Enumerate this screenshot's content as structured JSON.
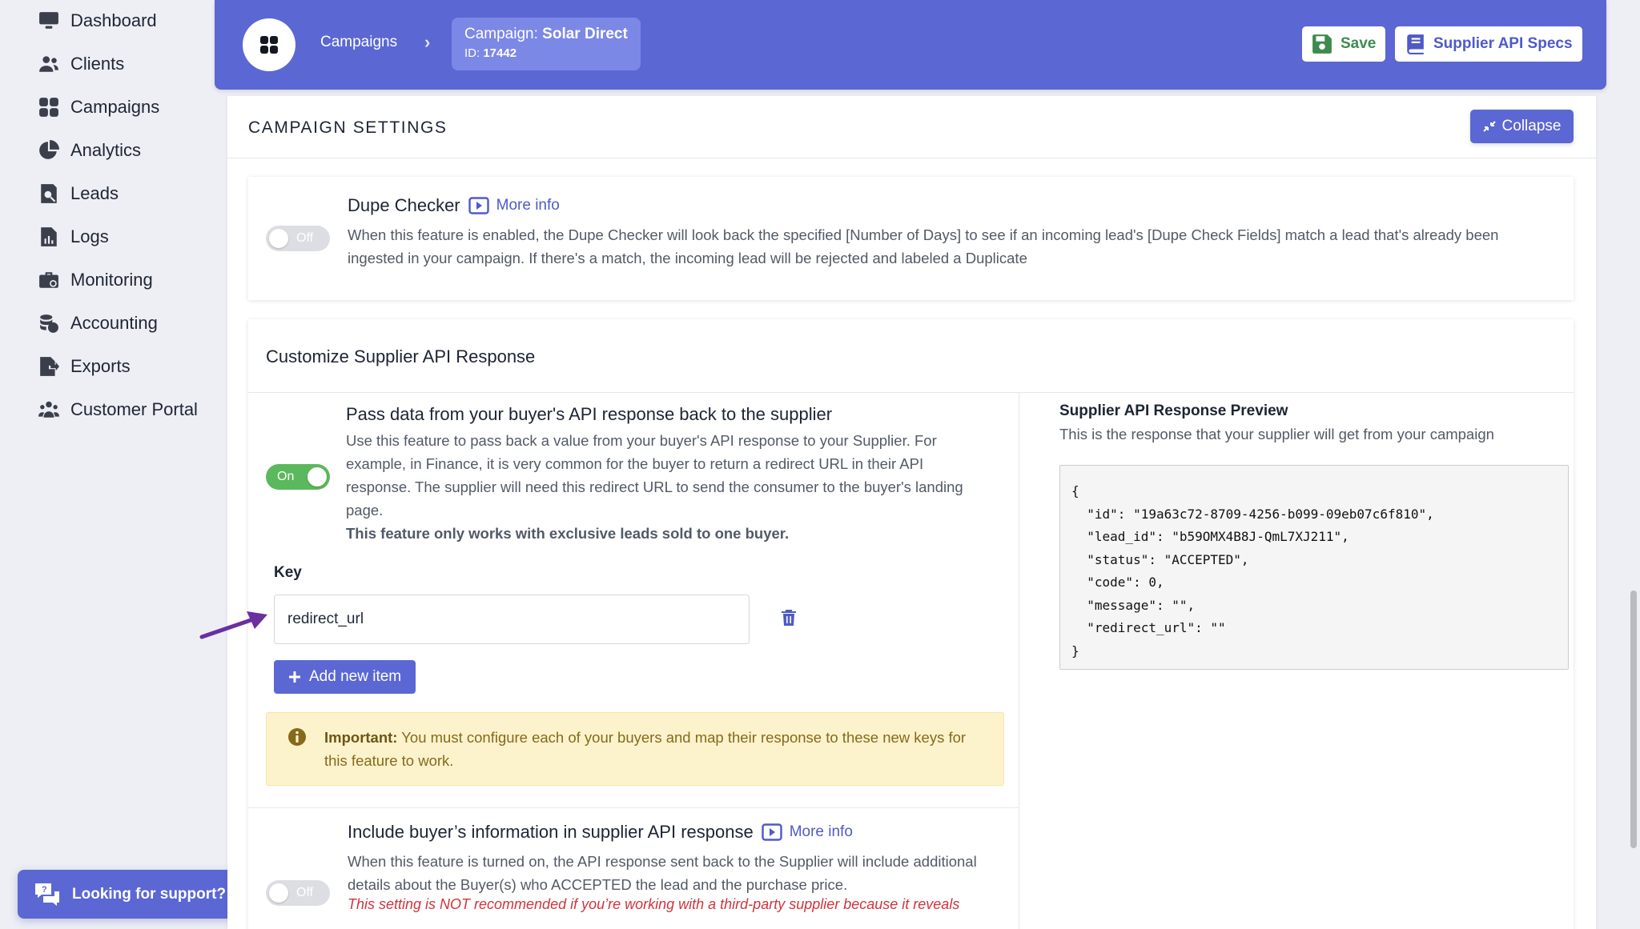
{
  "sidebar": {
    "items": [
      {
        "label": "Dashboard",
        "icon": "monitor-icon"
      },
      {
        "label": "Clients",
        "icon": "users-icon"
      },
      {
        "label": "Campaigns",
        "icon": "grid-icon"
      },
      {
        "label": "Analytics",
        "icon": "pie-chart-icon"
      },
      {
        "label": "Leads",
        "icon": "leads-icon"
      },
      {
        "label": "Logs",
        "icon": "file-chart-icon"
      },
      {
        "label": "Monitoring",
        "icon": "briefcase-icon"
      },
      {
        "label": "Accounting",
        "icon": "coins-icon"
      },
      {
        "label": "Exports",
        "icon": "file-export-icon"
      },
      {
        "label": "Customer Portal",
        "icon": "people-group-icon"
      }
    ],
    "support_label": "Looking for support?"
  },
  "header": {
    "crumb_link": "Campaigns",
    "crumb_chevron": "›",
    "campaign_prefix": "Campaign: ",
    "campaign_name": "Solar Direct",
    "id_prefix": "ID: ",
    "campaign_id": "17442",
    "save_label": "Save",
    "specs_label": "Supplier API Specs"
  },
  "settings": {
    "title": "CAMPAIGN SETTINGS",
    "collapse_label": "Collapse"
  },
  "dupe_checker": {
    "title": "Dupe Checker",
    "more_info": "More info",
    "toggle": "Off",
    "description": "When this feature is enabled, the Dupe Checker will look back the specified [Number of Days] to see if an incoming lead's [Dupe Check Fields] match a lead that's already been ingested in your campaign. If there's a match, the incoming lead will be rejected and labeled a Duplicate"
  },
  "customize": {
    "title": "Customize Supplier API Response",
    "pass_data": {
      "title": "Pass data from your buyer's API response back to the supplier",
      "toggle": "On",
      "description": "Use this feature to pass back a value from your buyer's API response to your Supplier. For example, in Finance, it is very common for the buyer to return a redirect URL in their API response. The supplier will need this redirect URL to send the consumer to the buyer's landing page.",
      "bold_note": "This feature only works with exclusive leads sold to one buyer.",
      "key_label": "Key",
      "key_value": "redirect_url",
      "add_label": "Add new item",
      "alert_strong": "Important:",
      "alert_text": " You must configure each of your buyers and map their response to these new keys for this feature to work."
    },
    "preview": {
      "title": "Supplier API Response Preview",
      "subtitle": "This is the response that your supplier will get from your campaign",
      "json": "{\n  \"id\": \"19a63c72-8709-4256-b099-09eb07c6f810\",\n  \"lead_id\": \"b59OMX4B8J-QmL7XJ211\",\n  \"status\": \"ACCEPTED\",\n  \"code\": 0,\n  \"message\": \"\",\n  \"redirect_url\": \"\"\n}"
    },
    "include_buyer": {
      "title": "Include buyer’s information in supplier API response",
      "more_info": "More info",
      "toggle": "Off",
      "description": "When this feature is turned on, the API response sent back to the Supplier will include additional details about the Buyer(s) who ACCEPTED the lead and the purchase price.",
      "warning": "This setting is NOT recommended if you’re working with a third-party supplier because it reveals"
    }
  },
  "colors": {
    "accent": "#5b67d3",
    "toggle_on": "#5cb85c",
    "toggle_off": "#dcdee3",
    "alert_bg": "#fcf3cd",
    "warning": "#d0343b"
  }
}
